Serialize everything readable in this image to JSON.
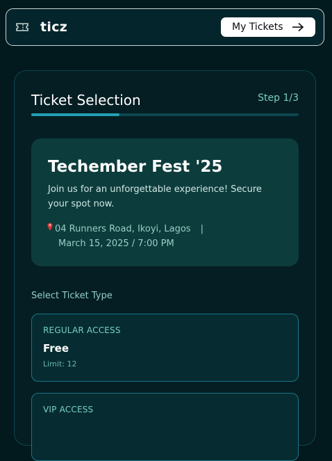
{
  "nav": {
    "logo_text": "ticz",
    "my_tickets_label": "My Tickets"
  },
  "form": {
    "title": "Ticket Selection",
    "step": "Step 1/3",
    "progress": 0.33
  },
  "event": {
    "title": "Techember Fest '25",
    "description": "Join us for an unforgettable experience! Secure your spot now.",
    "location": "04 Runners Road, Ikoyi, Lagos",
    "separator": "|",
    "datetime": "March 15, 2025 / 7:00 PM"
  },
  "ticket_section": {
    "label": "Select Ticket Type",
    "tickets": [
      {
        "type": "REGULAR ACCESS",
        "price": "Free",
        "limit": "Limit: 12"
      },
      {
        "type": "VIP ACCESS",
        "price": "",
        "limit": ""
      }
    ]
  },
  "icons": {
    "logo": "ticket-icon",
    "arrow": "arrow-right-icon",
    "location": "map-pin-icon"
  },
  "colors": {
    "background": "#02191d",
    "card": "#041e23",
    "accent": "#24a0b5",
    "event_box": "#0d3c3c"
  }
}
